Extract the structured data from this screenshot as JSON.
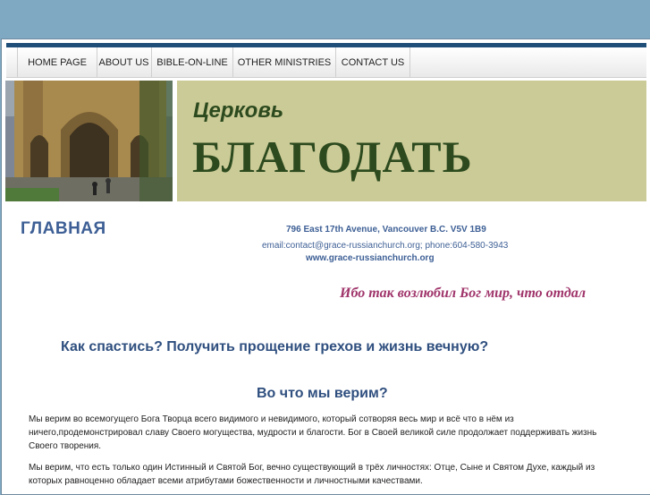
{
  "nav": {
    "items": [
      {
        "label": "HOME PAGE"
      },
      {
        "label": "ABOUT US"
      },
      {
        "label": "BIBLE-ON-LINE"
      },
      {
        "label": "OTHER MINISTRIES"
      },
      {
        "label": "CONTACT US"
      }
    ]
  },
  "banner": {
    "church_word": "Церковь",
    "church_name": "БЛАГОДАТЬ",
    "photo_icon": "cathedral-photo"
  },
  "main": {
    "heading": "ГЛАВНАЯ",
    "address": "796 East 17th Avenue, Vancouver B.C. V5V 1B9",
    "contact": "email:contact@grace-russianchurch.org; phone:604-580-3943",
    "website": "www.grace-russianchurch.org",
    "verse": "Ибо так возлюбил Бог мир, что отдал",
    "question1": "Как спастись? Получить прощение грехов и жизнь вечную?",
    "question2": "Во что мы верим?",
    "paragraph1": "Мы верим во всемогущего Бога Творца всего видимого и невидимого, который сотворяя весь мир и всё что в нём из ничего,продемонстрировал славу Своего могущества, мудрости и благости. Бог в Своей великой силе продолжает поддерживать жизнь Своего творения.",
    "paragraph2": "Мы верим, что есть только один Истинный и Святой Бог, вечно существующий в трёх личностях: Отце, Сыне и Святом Духе, каждый из которых равноценно обладает всеми атрибутами божественности и личностными качествами."
  },
  "colors": {
    "background": "#7fa9c3",
    "nav_bar_accent": "#1f4e79",
    "banner_background": "#cbcb97",
    "banner_text": "#2c4a1e",
    "heading_blue": "#3d5f95",
    "verse_color": "#a0356b"
  }
}
